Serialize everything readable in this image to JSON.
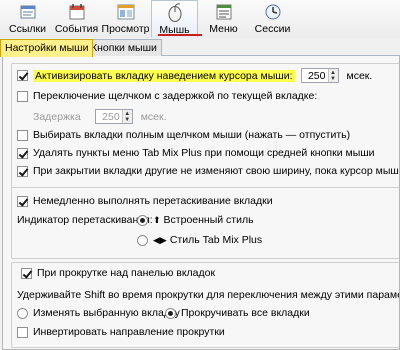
{
  "toolbar": {
    "items": [
      {
        "label": "Ссылки",
        "icon": "links-icon"
      },
      {
        "label": "События",
        "icon": "events-icon"
      },
      {
        "label": "Просмотр",
        "icon": "view-icon"
      },
      {
        "label": "Мышь",
        "icon": "mouse-icon",
        "active": true
      },
      {
        "label": "Меню",
        "icon": "menu-icon"
      },
      {
        "label": "Сессии",
        "icon": "sessions-icon"
      }
    ]
  },
  "subtabs": [
    {
      "label": "Настройки мыши",
      "selected": true
    },
    {
      "label": "Кнопки мыши",
      "selected": false
    }
  ],
  "settings": {
    "hover_activate": {
      "label": "Активизировать вкладку наведением курсора мыши:",
      "checked": true,
      "value": "250",
      "unit": "мсек."
    },
    "click_delay": {
      "label": "Переключение щелчком с задержкой по текущей вкладке:",
      "checked": false
    },
    "delay": {
      "label": "Задержка",
      "value": "250",
      "unit": "мсек."
    },
    "full_click": {
      "label": "Выбирать вкладки полным щелчком мыши (нажать — отпустить)",
      "checked": false
    },
    "middle_click": {
      "label": "Удалять пункты меню Tab Mix Plus при помощи средней кнопки мыши",
      "checked": true
    },
    "close_width": {
      "label": "При закрытии вкладки другие не изменяют свою ширину, пока курсор мыши не покинет обл",
      "checked": true
    },
    "drag_now": {
      "label": "Немедленно выполнять перетаскивание вкладки",
      "checked": true
    },
    "drag_indicator": {
      "label": "Индикатор перетаскивания:",
      "options": [
        {
          "label": "Встроенный стиль",
          "selected": true
        },
        {
          "label": "Стиль Tab Mix Plus",
          "selected": false
        }
      ]
    },
    "scroll": {
      "label": "При прокрутке над панелью вкладок",
      "checked": true
    },
    "shift_hint": "Удерживайте Shift во время прокрутки для переключения между этими параметрами",
    "scroll_options": [
      {
        "label": "Изменять выбранную вкладку",
        "selected": false
      },
      {
        "label": "Прокручивать все вкладки",
        "selected": true
      }
    ],
    "invert": {
      "label": "Инвертировать направление прокрутки",
      "checked": false
    }
  },
  "colors": {
    "highlight": "#ffff4d",
    "accent": "#c81e1e",
    "selected_tab": "#fff08a"
  }
}
